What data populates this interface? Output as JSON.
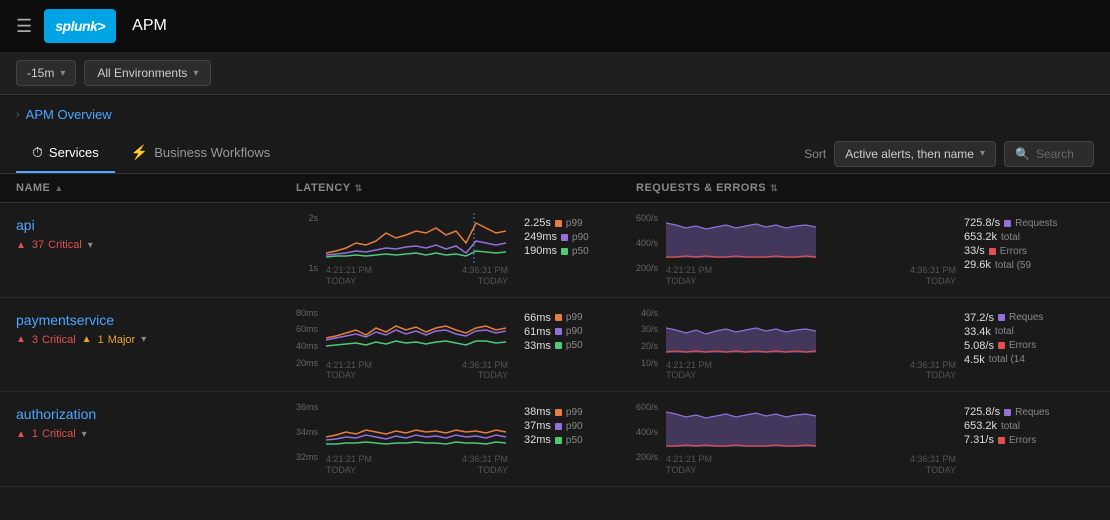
{
  "header": {
    "menu_icon": "☰",
    "logo_text": "splunk>",
    "app_title": "APM"
  },
  "toolbar": {
    "time": "-15m",
    "environment": "All Environments"
  },
  "breadcrumb": {
    "label": "APM Overview"
  },
  "tabs": [
    {
      "id": "services",
      "label": "Services",
      "active": true
    },
    {
      "id": "workflows",
      "label": "Business Workflows",
      "active": false
    }
  ],
  "sort": {
    "label": "Sort",
    "value": "Active alerts, then name"
  },
  "search": {
    "placeholder": "Search"
  },
  "table": {
    "columns": [
      {
        "id": "name",
        "label": "NAME"
      },
      {
        "id": "latency",
        "label": "LATENCY"
      },
      {
        "id": "requests",
        "label": "REQUESTS & ERRORS"
      }
    ]
  },
  "services": [
    {
      "name": "api",
      "alerts": [
        {
          "type": "critical",
          "count": 37,
          "label": "Critical"
        }
      ],
      "latency": {
        "y_labels": [
          "2s",
          "1s"
        ],
        "x_labels": [
          "4:21:21 PM\nTODAY",
          "4:36:31 PM\nTODAY"
        ],
        "metrics": [
          {
            "val": "2.25s",
            "color": "#e87d3e",
            "label": "p99"
          },
          {
            "val": "249ms",
            "color": "#9370db",
            "label": "p90"
          },
          {
            "val": "190ms",
            "color": "#50c878",
            "label": "p50"
          }
        ]
      },
      "requests": {
        "y_labels": [
          "600/s",
          "400/s",
          "200/s"
        ],
        "x_labels": [
          "4:21:21 PM\nTODAY",
          "4:36:31 PM\nTODAY"
        ],
        "metrics": [
          {
            "val": "725.8/s",
            "color": "#9370db",
            "label": "Requests"
          },
          {
            "val": "653.2k",
            "color": null,
            "label": "total"
          },
          {
            "val": "33/s",
            "color": "#e05252",
            "label": "Errors"
          },
          {
            "val": "29.6k",
            "color": null,
            "label": "total (59"
          }
        ]
      }
    },
    {
      "name": "paymentservice",
      "alerts": [
        {
          "type": "critical",
          "count": 3,
          "label": "Critical"
        },
        {
          "type": "major",
          "count": 1,
          "label": "Major"
        }
      ],
      "latency": {
        "y_labels": [
          "80ms",
          "60ms",
          "40ms",
          "20ms"
        ],
        "x_labels": [
          "4:21:21 PM\nTODAY",
          "4:36:31 PM\nTODAY"
        ],
        "metrics": [
          {
            "val": "66ms",
            "color": "#e87d3e",
            "label": "p99"
          },
          {
            "val": "61ms",
            "color": "#9370db",
            "label": "p90"
          },
          {
            "val": "33ms",
            "color": "#50c878",
            "label": "p50"
          }
        ]
      },
      "requests": {
        "y_labels": [
          "40/s",
          "30/s",
          "20/s",
          "10/s"
        ],
        "x_labels": [
          "4:21:21 PM\nTODAY",
          "4:36:31 PM\nTODAY"
        ],
        "metrics": [
          {
            "val": "37.2/s",
            "color": "#9370db",
            "label": "Reques"
          },
          {
            "val": "33.4k",
            "color": null,
            "label": "total"
          },
          {
            "val": "5.08/s",
            "color": "#e05252",
            "label": "Errors"
          },
          {
            "val": "4.5k",
            "color": null,
            "label": "total (14"
          }
        ]
      }
    },
    {
      "name": "authorization",
      "alerts": [
        {
          "type": "critical",
          "count": 1,
          "label": "Critical"
        }
      ],
      "latency": {
        "y_labels": [
          "36ms",
          "34ms",
          "32ms"
        ],
        "x_labels": [
          "4:21:21 PM\nTODAY",
          "4:36:31 PM\nTODAY"
        ],
        "metrics": [
          {
            "val": "38ms",
            "color": "#e87d3e",
            "label": "p99"
          },
          {
            "val": "37ms",
            "color": "#9370db",
            "label": "p90"
          },
          {
            "val": "32ms",
            "color": "#50c878",
            "label": "p50"
          }
        ]
      },
      "requests": {
        "y_labels": [
          "600/s",
          "400/s",
          "200/s"
        ],
        "x_labels": [
          "4:21:21 PM\nTODAY",
          "4:36:31 PM\nTODAY"
        ],
        "metrics": [
          {
            "val": "725.8/s",
            "color": "#9370db",
            "label": "Reques"
          },
          {
            "val": "653.2k",
            "color": null,
            "label": "total"
          },
          {
            "val": "7.31/s",
            "color": "#e05252",
            "label": "Errors"
          }
        ]
      }
    }
  ]
}
